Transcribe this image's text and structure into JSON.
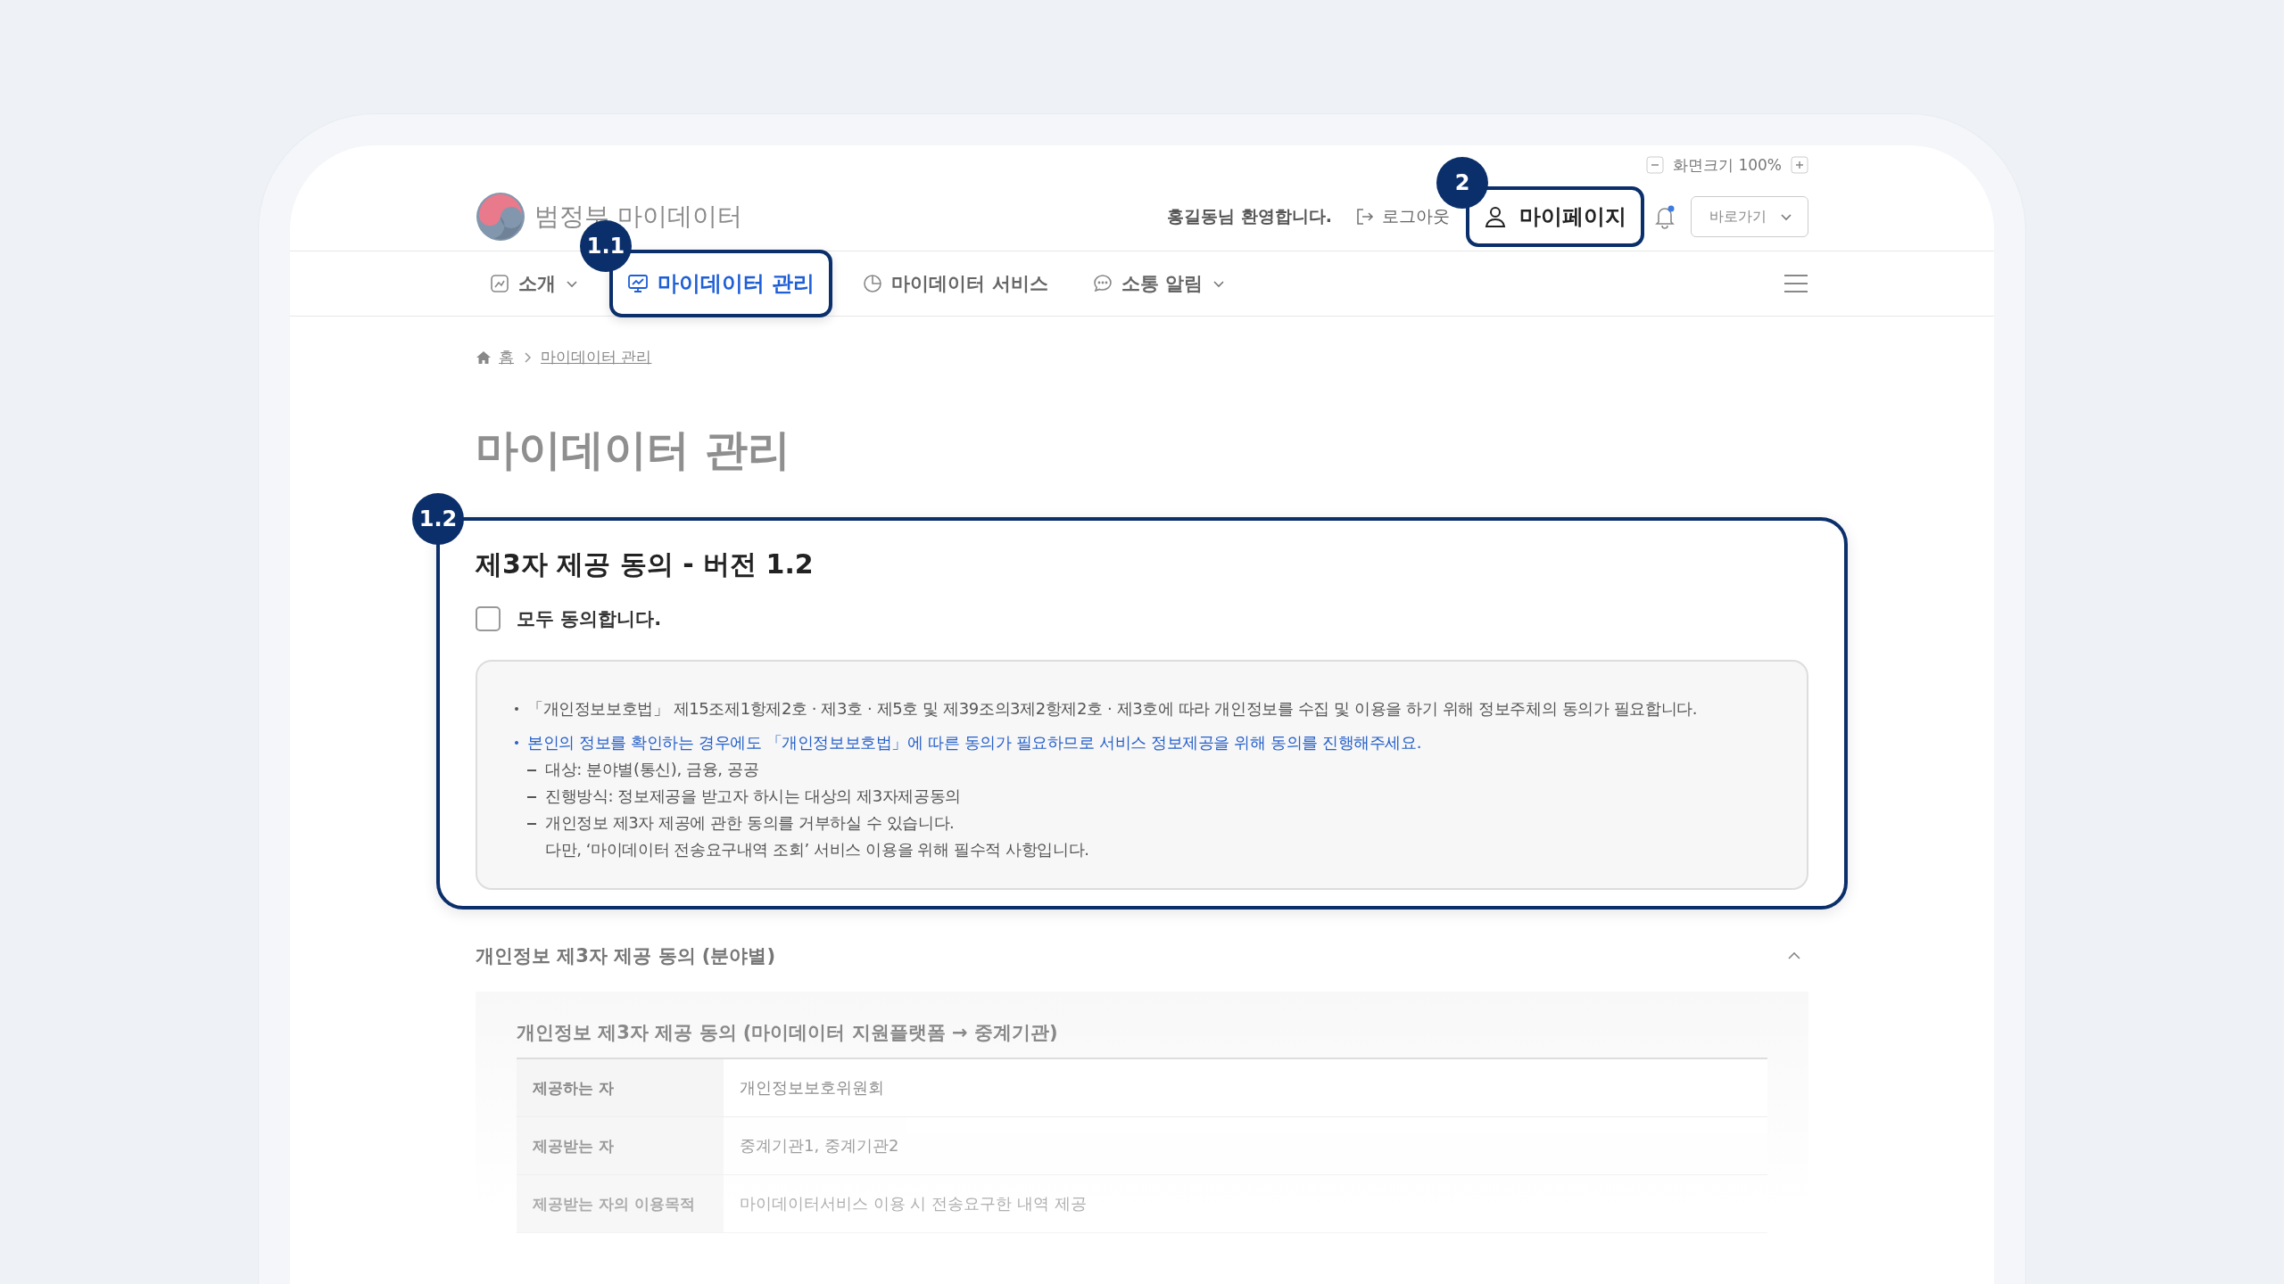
{
  "zoom_control": {
    "label": "화면크기 100%"
  },
  "header": {
    "logo_text": "범정부 마이데이터",
    "welcome": "홍길동님 환영합니다.",
    "logout": "로그아웃",
    "mypage": {
      "label": "마이페이지",
      "badge": "2"
    },
    "shortcut": "바로가기"
  },
  "nav": [
    {
      "label": "소개",
      "dropdown": true,
      "selected": false
    },
    {
      "label": "마이데이터 관리",
      "dropdown": false,
      "selected": true,
      "badge": "1.1"
    },
    {
      "label": "마이데이터 서비스",
      "dropdown": false,
      "selected": false
    },
    {
      "label": "소통 알림",
      "dropdown": true,
      "selected": false
    }
  ],
  "breadcrumb": [
    "홈",
    "마이데이터 관리"
  ],
  "page_title": "마이데이터 관리",
  "consent": {
    "badge": "1.2",
    "title": "제3자 제공 동의 - 버전 1.2",
    "agree_all": {
      "label": "모두 동의합니다.",
      "checked": false
    },
    "notes": [
      {
        "kind": "bullet",
        "lines": [
          "「개인정보보호법」 제15조제1항제2호 · 제3호 · 제5호 및 제39조의3제2항제2호 · 제3호에 따라 개인정보를 수집 및 이용을 하기 위해 정보주체의 동의가 필요합니다."
        ]
      },
      {
        "kind": "highlight",
        "lines": [
          "본인의 정보를 확인하는 경우에도 「개인정보보호법」에 따른 동의가 필요하므로 서비스 정보제공을 위해 동의를 진행해주세요."
        ]
      },
      {
        "kind": "dash",
        "lines": [
          "대상: 분야별(통신), 금융, 공공"
        ]
      },
      {
        "kind": "dash",
        "lines": [
          "진행방식: 정보제공을 받고자 하시는 대상의 제3자제공동의"
        ]
      },
      {
        "kind": "dash",
        "lines": [
          "개인정보 제3자 제공에 관한 동의를 거부하실 수 있습니다.",
          "다만, ‘마이데이터 전송요구내역 조회’ 서비스 이용을 위해 필수적 사항입니다."
        ]
      }
    ]
  },
  "section": {
    "title": "개인정보 제3자 제공 동의 (분야별)",
    "expanded": true,
    "panel": {
      "title": "개인정보 제3자 제공 동의 (마이데이터 지원플랫폼 → 중계기관)",
      "rows": [
        {
          "label": "제공하는 자",
          "value": "개인정보보호위원회"
        },
        {
          "label": "제공받는 자",
          "value": "중계기관1, 중계기관2"
        },
        {
          "label": "제공받는 자의 이용목적",
          "value": "마이데이터서비스 이용 시 전송요구한 내역 제공"
        }
      ]
    }
  }
}
